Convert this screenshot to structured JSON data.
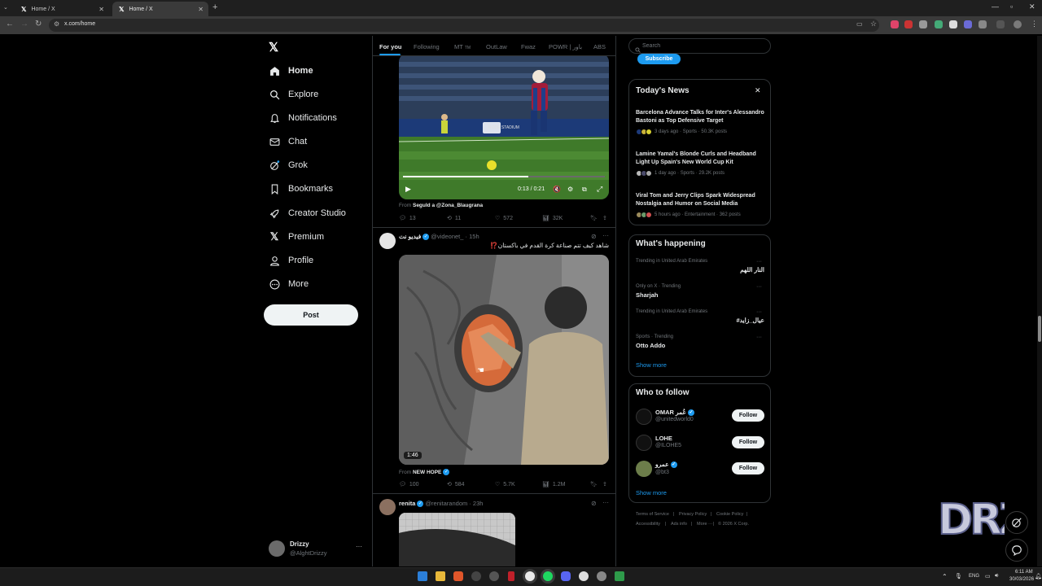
{
  "browser": {
    "tabs": [
      {
        "title": "Home / X",
        "active": false
      },
      {
        "title": "Home / X",
        "active": true
      }
    ],
    "url": "x.com/home"
  },
  "nav": {
    "items": [
      {
        "label": "Home",
        "icon": "home-icon",
        "active": true
      },
      {
        "label": "Explore",
        "icon": "search-icon"
      },
      {
        "label": "Notifications",
        "icon": "bell-icon"
      },
      {
        "label": "Chat",
        "icon": "mail-icon"
      },
      {
        "label": "Grok",
        "icon": "grok-icon"
      },
      {
        "label": "Bookmarks",
        "icon": "bookmark-icon"
      },
      {
        "label": "Creator Studio",
        "icon": "rocket-icon"
      },
      {
        "label": "Premium",
        "icon": "x-icon"
      },
      {
        "label": "Profile",
        "icon": "person-icon"
      },
      {
        "label": "More",
        "icon": "more-circle-icon"
      }
    ],
    "post_label": "Post"
  },
  "account": {
    "name": "Drizzy",
    "handle": "@AlghtDrizzy"
  },
  "feed": {
    "tabs": [
      {
        "label": "For you",
        "active": true
      },
      {
        "label": "Following"
      },
      {
        "label": "MT"
      },
      {
        "label": "OutLaw"
      },
      {
        "label": "Fwaz"
      },
      {
        "label": "POWR | باور"
      },
      {
        "label": "ABS"
      }
    ],
    "tab_badge": "TM",
    "post1": {
      "video_time": "0:13 / 0:21",
      "video_progress": 0.62,
      "from_prefix": "From",
      "from_name": "Seguld a @Zona_Blaugrana",
      "replies": "13",
      "reposts": "11",
      "likes": "572",
      "views": "32K",
      "stadium_text": "RODE STADIUM"
    },
    "post2": {
      "name": "فيديو نت",
      "handle": "@videonet_",
      "time": "15h",
      "text": "شاهد كيف تتم صناعة كرة القدم في باكستان",
      "emoji": "⁉️",
      "duration": "1:46",
      "from_prefix": "From",
      "from_name": "NEW HOPE",
      "replies": "100",
      "reposts": "584",
      "likes": "5.7K",
      "views": "1.2M"
    },
    "post3": {
      "name": "renita",
      "handle": "@renitarandom",
      "time": "23h"
    }
  },
  "right": {
    "search_placeholder": "Search",
    "subscribe_label": "Subscribe",
    "news": {
      "title": "Today's News",
      "items": [
        {
          "headline": "Barcelona Advance Talks for Inter's Alessandro Bastoni as Top Defensive Target",
          "meta": "3 days ago · Sports · 50.3K posts"
        },
        {
          "headline": "Lamine Yamal's Blonde Curls and Headband Light Up Spain's New World Cup Kit",
          "meta": "1 day ago · Sports · 29.2K posts"
        },
        {
          "headline": "Viral Tom and Jerry Clips Spark Widespread Nostalgia and Humor on Social Media",
          "meta": "5 hours ago · Entertainment · 362 posts"
        }
      ]
    },
    "happening": {
      "title": "What's happening",
      "items": [
        {
          "context": "Trending in United Arab Emirates",
          "name": "النار اللهم"
        },
        {
          "context": "Only on X · Trending",
          "name": "Sharjah"
        },
        {
          "context": "Trending in United Arab Emirates",
          "name": "#عيال_زايد"
        },
        {
          "context": "Sports · Trending",
          "name": "Otto Addo"
        }
      ],
      "show_more": "Show more"
    },
    "who_to_follow": {
      "title": "Who to follow",
      "items": [
        {
          "name": "OMAR عُمر",
          "handle": "@unitedworld0",
          "verified": true
        },
        {
          "name": "LOHE",
          "handle": "@ILOHE5",
          "verified": false
        },
        {
          "name": "عمرو",
          "handle": "@bt3",
          "verified": true
        }
      ],
      "follow_label": "Follow",
      "show_more": "Show more"
    },
    "footer": {
      "row1": [
        "Terms of Service",
        "Privacy Policy",
        "Cookie Policy"
      ],
      "row2": [
        "Accessibility",
        "Ads info",
        "More ···",
        "© 2026 X Corp."
      ]
    }
  },
  "taskbar": {
    "lang": "ENG",
    "time": "6:11 AM",
    "date": "30/03/2026"
  },
  "watermark": "DRZ",
  "colors": {
    "accent": "#1d9bf0",
    "bg": "#000000",
    "border": "#2f3336",
    "muted": "#71767b"
  }
}
